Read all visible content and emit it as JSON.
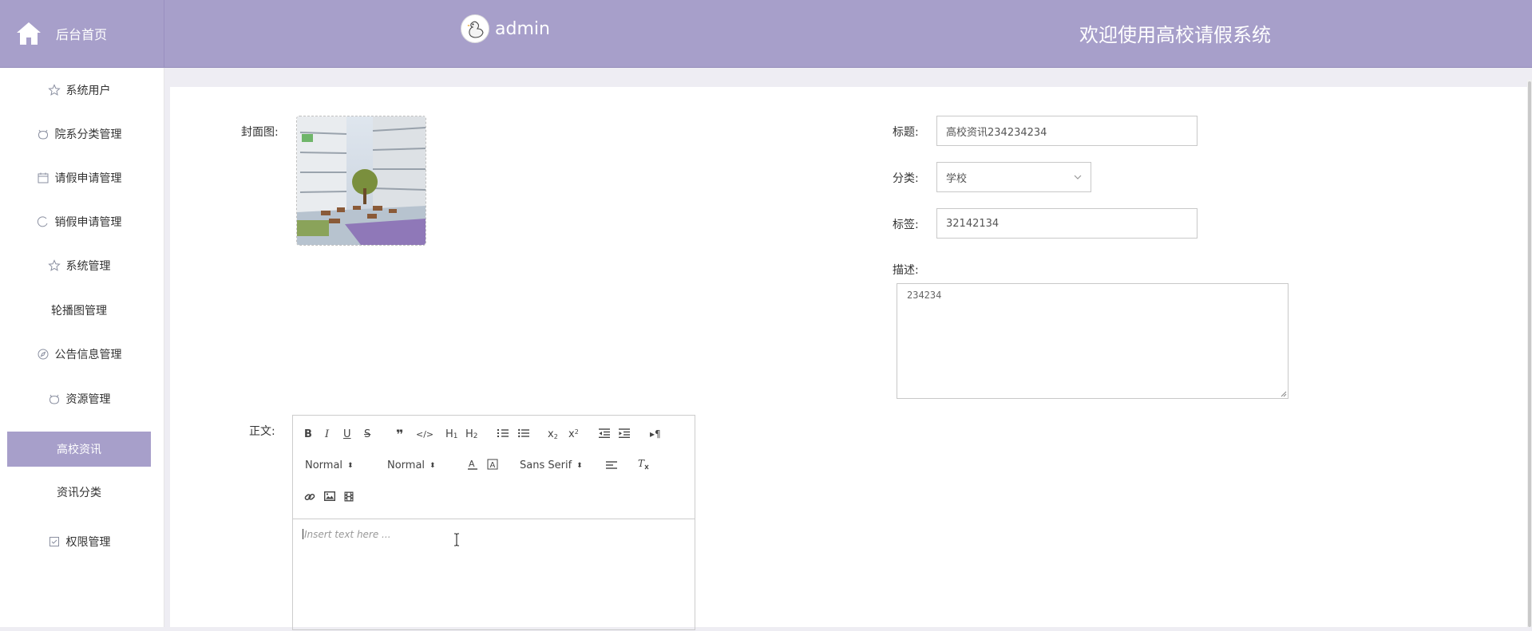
{
  "header": {
    "home_label": "后台首页",
    "home_icon": "home-icon",
    "username": "admin",
    "welcome": "欢迎使用高校请假系统",
    "theme_color": "#a79fca"
  },
  "sidebar": {
    "items": [
      {
        "label": "系统用户",
        "icon": "star-icon"
      },
      {
        "label": "院系分类管理",
        "icon": "cat-icon"
      },
      {
        "label": "请假申请管理",
        "icon": "calendar-icon"
      },
      {
        "label": "销假申请管理",
        "icon": "refresh-icon"
      },
      {
        "label": "系统管理",
        "icon": "star-icon"
      },
      {
        "label": "轮播图管理",
        "icon": ""
      },
      {
        "label": "公告信息管理",
        "icon": "compass-icon"
      },
      {
        "label": "资源管理",
        "icon": "cat-icon"
      },
      {
        "label": "高校资讯",
        "icon": "",
        "active": true
      },
      {
        "label": "资讯分类",
        "icon": ""
      },
      {
        "label": "权限管理",
        "icon": "checkbox-icon"
      }
    ]
  },
  "form": {
    "cover_label": "封面图:",
    "title_label": "标题:",
    "title_value": "高校资讯234234234",
    "category_label": "分类:",
    "category_value": "学校",
    "tags_label": "标签:",
    "tags_value": "32142134",
    "desc_label": "描述:",
    "desc_value": "234234",
    "body_label": "正文:"
  },
  "editor": {
    "header_select": "Normal",
    "size_select": "Normal",
    "font_select": "Sans Serif",
    "placeholder": "Insert text here ..."
  }
}
